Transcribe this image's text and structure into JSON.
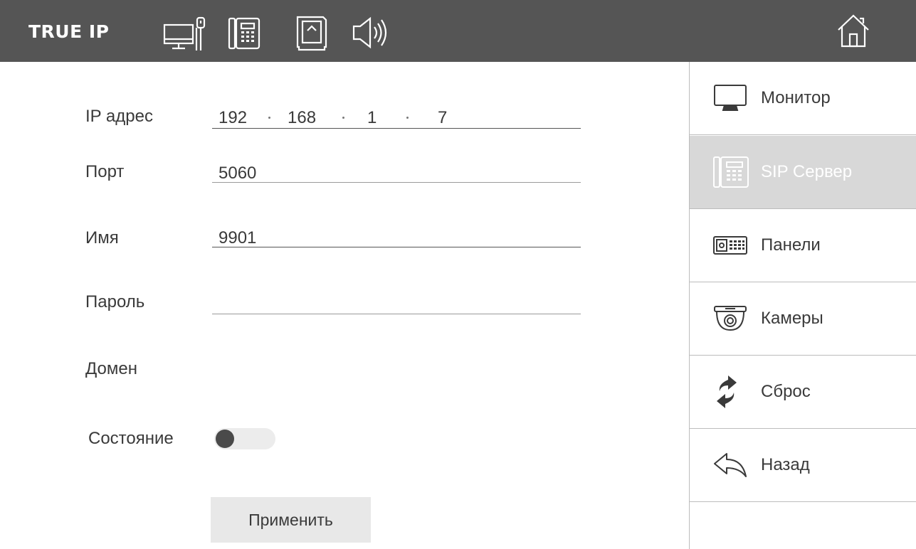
{
  "header": {
    "brand": "TRUE IP",
    "icons": [
      "monitor-network-icon",
      "sip-phone-icon",
      "sd-card-icon",
      "speaker-icon",
      "home-icon"
    ]
  },
  "form": {
    "ip_label": "IP адрес",
    "ip_parts": [
      "192",
      "168",
      "1",
      "7"
    ],
    "port_label": "Порт",
    "port_value": "5060",
    "name_label": "Имя",
    "name_value": "9901",
    "password_label": "Пароль",
    "password_value": "",
    "domain_label": "Домен",
    "state_label": "Состояние",
    "state_on": false,
    "apply_label": "Применить"
  },
  "sidebar": {
    "items": [
      {
        "label": "Монитор",
        "icon": "monitor-icon",
        "active": false
      },
      {
        "label": "SIP Сервер",
        "icon": "sip-phone-icon",
        "active": true
      },
      {
        "label": "Панели",
        "icon": "door-panel-icon",
        "active": false
      },
      {
        "label": "Камеры",
        "icon": "dome-camera-icon",
        "active": false
      },
      {
        "label": "Сброс",
        "icon": "reset-arrows-icon",
        "active": false
      },
      {
        "label": "Назад",
        "icon": "back-arrow-icon",
        "active": false
      }
    ]
  },
  "colors": {
    "header_bg": "#555555",
    "active_item_bg": "#d8d8d8",
    "button_bg": "#e8e8e8"
  }
}
